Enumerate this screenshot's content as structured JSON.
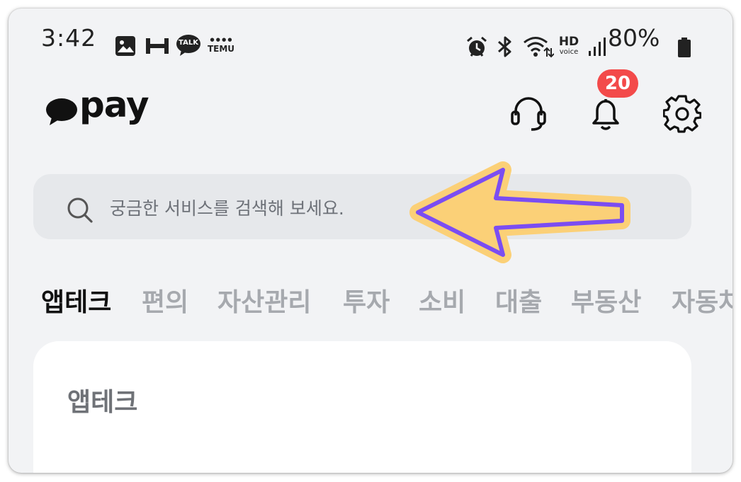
{
  "status_bar": {
    "time": "3:42",
    "notif_talk": "TALK",
    "notif_temu": "TEMU",
    "hd_label": "HD",
    "voice_label": "voice",
    "battery": "80%"
  },
  "header": {
    "logo_text": "pay",
    "notification_count": "20"
  },
  "search": {
    "placeholder": "궁금한 서비스를 검색해 보세요."
  },
  "tabs": [
    {
      "label": "앱테크",
      "active": true
    },
    {
      "label": "편의"
    },
    {
      "label": "자산관리"
    },
    {
      "label": "투자"
    },
    {
      "label": "소비"
    },
    {
      "label": "대출"
    },
    {
      "label": "부동산"
    },
    {
      "label": "자동차"
    }
  ],
  "section": {
    "title": "앱테크"
  },
  "colors": {
    "background": "#f2f3f5",
    "badge": "#f34a4a",
    "arrow_fill": "#fbd077",
    "arrow_stroke": "#7b4df2"
  }
}
